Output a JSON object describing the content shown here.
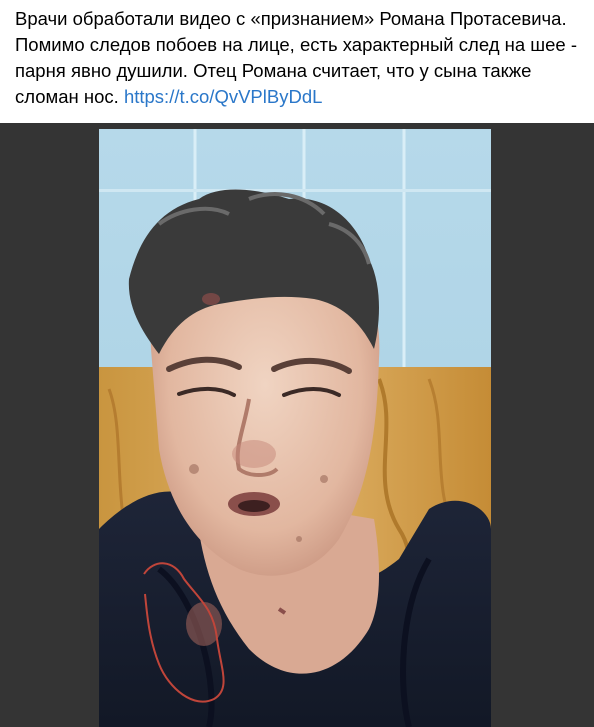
{
  "post": {
    "lines": [
      "Врачи обработали видео с «признанием» Романа Протасевича.",
      "Помимо следов побоев на лице, есть характерный след на шее -",
      "парня явно душили. Отец Романа считает, что у сына также",
      "сломан нос."
    ],
    "link": "https://t.co/QvVPlByDdL"
  },
  "media": {
    "description_icon": "photo-icon",
    "annotation_color": "#c0453a",
    "background_color": "#343434"
  }
}
